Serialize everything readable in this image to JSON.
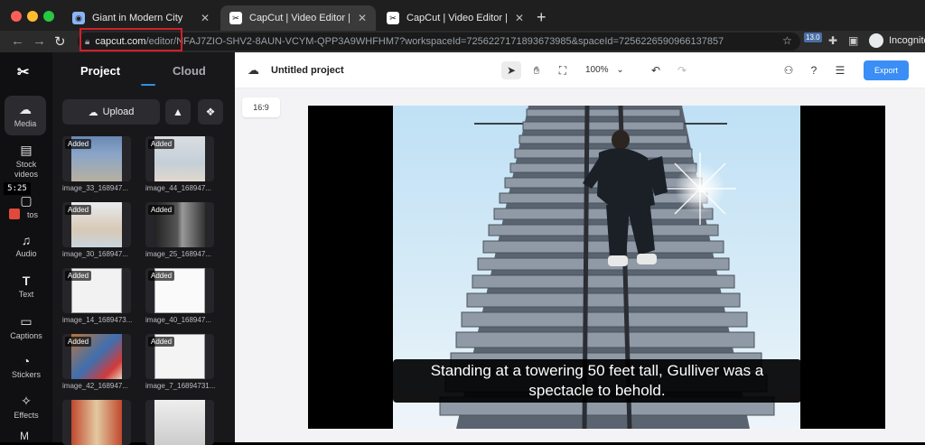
{
  "browser": {
    "tabs": [
      {
        "title": "Giant in Modern City",
        "favicon": "globe-icon"
      },
      {
        "title": "CapCut | Video Editor | All-In-O",
        "favicon": "capcut-icon"
      },
      {
        "title": "CapCut | Video Editor | All-In-O",
        "favicon": "capcut-icon"
      }
    ],
    "url_domain": "capcut.com",
    "url_path": "/editor/NFAJ7ZIO-SHV2-8AUN-VCYM-QPP3A9WHFHM7?workspaceId=7256227171893673985&spaceId=7256226590966137857",
    "extension_badge": "13.0",
    "profile_label": "Incognito"
  },
  "sidebar": {
    "items": [
      {
        "label": "Media",
        "icon": "cloud-upload-icon"
      },
      {
        "label": "Stock videos",
        "icon": "film-icon"
      },
      {
        "label": "tos",
        "icon": "photo-icon"
      },
      {
        "label": "Audio",
        "icon": "music-note-icon"
      },
      {
        "label": "Text",
        "icon": "text-icon"
      },
      {
        "label": "Captions",
        "icon": "captions-icon"
      },
      {
        "label": "Stickers",
        "icon": "sticker-icon"
      },
      {
        "label": "Effects",
        "icon": "sparkle-icon"
      }
    ],
    "timer": "5:25"
  },
  "media_panel": {
    "tabs": [
      "Project",
      "Cloud"
    ],
    "upload_label": "Upload",
    "badge": "Added",
    "items": [
      "image_33_168947...",
      "image_44_168947...",
      "image_30_168947...",
      "image_25_168947...",
      "image_14_1689473...",
      "image_40_168947...",
      "image_42_168947...",
      "image_7_16894731...",
      "",
      ""
    ]
  },
  "toolbar": {
    "project_title": "Untitled project",
    "zoom": "100%",
    "export_label": "Export"
  },
  "canvas": {
    "ratio": "16:9",
    "subtitle_line1": "Standing at a towering 50 feet tall, Gulliver was a",
    "subtitle_line2": "spectacle to behold."
  },
  "colors": {
    "accent": "#3a8ef5",
    "highlight_box": "#d21f2b",
    "panel_bg": "#18181b"
  }
}
